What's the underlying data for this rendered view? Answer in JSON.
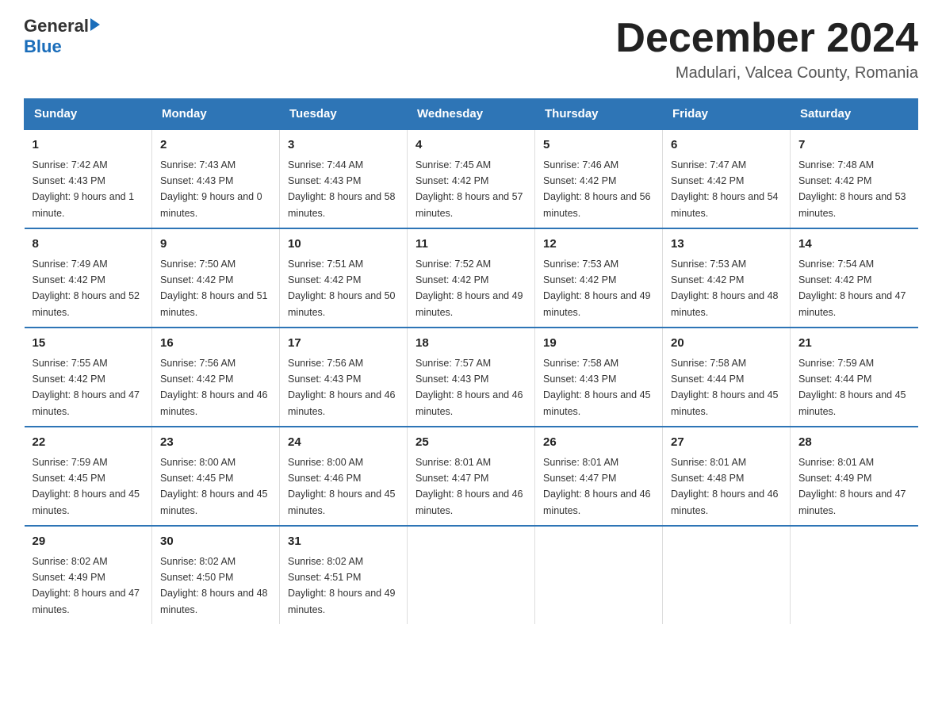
{
  "header": {
    "logo_general": "General",
    "logo_blue": "Blue",
    "month_title": "December 2024",
    "location": "Madulari, Valcea County, Romania"
  },
  "days_of_week": [
    "Sunday",
    "Monday",
    "Tuesday",
    "Wednesday",
    "Thursday",
    "Friday",
    "Saturday"
  ],
  "weeks": [
    [
      {
        "day": "1",
        "sunrise": "7:42 AM",
        "sunset": "4:43 PM",
        "daylight": "9 hours and 1 minute."
      },
      {
        "day": "2",
        "sunrise": "7:43 AM",
        "sunset": "4:43 PM",
        "daylight": "9 hours and 0 minutes."
      },
      {
        "day": "3",
        "sunrise": "7:44 AM",
        "sunset": "4:43 PM",
        "daylight": "8 hours and 58 minutes."
      },
      {
        "day": "4",
        "sunrise": "7:45 AM",
        "sunset": "4:42 PM",
        "daylight": "8 hours and 57 minutes."
      },
      {
        "day": "5",
        "sunrise": "7:46 AM",
        "sunset": "4:42 PM",
        "daylight": "8 hours and 56 minutes."
      },
      {
        "day": "6",
        "sunrise": "7:47 AM",
        "sunset": "4:42 PM",
        "daylight": "8 hours and 54 minutes."
      },
      {
        "day": "7",
        "sunrise": "7:48 AM",
        "sunset": "4:42 PM",
        "daylight": "8 hours and 53 minutes."
      }
    ],
    [
      {
        "day": "8",
        "sunrise": "7:49 AM",
        "sunset": "4:42 PM",
        "daylight": "8 hours and 52 minutes."
      },
      {
        "day": "9",
        "sunrise": "7:50 AM",
        "sunset": "4:42 PM",
        "daylight": "8 hours and 51 minutes."
      },
      {
        "day": "10",
        "sunrise": "7:51 AM",
        "sunset": "4:42 PM",
        "daylight": "8 hours and 50 minutes."
      },
      {
        "day": "11",
        "sunrise": "7:52 AM",
        "sunset": "4:42 PM",
        "daylight": "8 hours and 49 minutes."
      },
      {
        "day": "12",
        "sunrise": "7:53 AM",
        "sunset": "4:42 PM",
        "daylight": "8 hours and 49 minutes."
      },
      {
        "day": "13",
        "sunrise": "7:53 AM",
        "sunset": "4:42 PM",
        "daylight": "8 hours and 48 minutes."
      },
      {
        "day": "14",
        "sunrise": "7:54 AM",
        "sunset": "4:42 PM",
        "daylight": "8 hours and 47 minutes."
      }
    ],
    [
      {
        "day": "15",
        "sunrise": "7:55 AM",
        "sunset": "4:42 PM",
        "daylight": "8 hours and 47 minutes."
      },
      {
        "day": "16",
        "sunrise": "7:56 AM",
        "sunset": "4:42 PM",
        "daylight": "8 hours and 46 minutes."
      },
      {
        "day": "17",
        "sunrise": "7:56 AM",
        "sunset": "4:43 PM",
        "daylight": "8 hours and 46 minutes."
      },
      {
        "day": "18",
        "sunrise": "7:57 AM",
        "sunset": "4:43 PM",
        "daylight": "8 hours and 46 minutes."
      },
      {
        "day": "19",
        "sunrise": "7:58 AM",
        "sunset": "4:43 PM",
        "daylight": "8 hours and 45 minutes."
      },
      {
        "day": "20",
        "sunrise": "7:58 AM",
        "sunset": "4:44 PM",
        "daylight": "8 hours and 45 minutes."
      },
      {
        "day": "21",
        "sunrise": "7:59 AM",
        "sunset": "4:44 PM",
        "daylight": "8 hours and 45 minutes."
      }
    ],
    [
      {
        "day": "22",
        "sunrise": "7:59 AM",
        "sunset": "4:45 PM",
        "daylight": "8 hours and 45 minutes."
      },
      {
        "day": "23",
        "sunrise": "8:00 AM",
        "sunset": "4:45 PM",
        "daylight": "8 hours and 45 minutes."
      },
      {
        "day": "24",
        "sunrise": "8:00 AM",
        "sunset": "4:46 PM",
        "daylight": "8 hours and 45 minutes."
      },
      {
        "day": "25",
        "sunrise": "8:01 AM",
        "sunset": "4:47 PM",
        "daylight": "8 hours and 46 minutes."
      },
      {
        "day": "26",
        "sunrise": "8:01 AM",
        "sunset": "4:47 PM",
        "daylight": "8 hours and 46 minutes."
      },
      {
        "day": "27",
        "sunrise": "8:01 AM",
        "sunset": "4:48 PM",
        "daylight": "8 hours and 46 minutes."
      },
      {
        "day": "28",
        "sunrise": "8:01 AM",
        "sunset": "4:49 PM",
        "daylight": "8 hours and 47 minutes."
      }
    ],
    [
      {
        "day": "29",
        "sunrise": "8:02 AM",
        "sunset": "4:49 PM",
        "daylight": "8 hours and 47 minutes."
      },
      {
        "day": "30",
        "sunrise": "8:02 AM",
        "sunset": "4:50 PM",
        "daylight": "8 hours and 48 minutes."
      },
      {
        "day": "31",
        "sunrise": "8:02 AM",
        "sunset": "4:51 PM",
        "daylight": "8 hours and 49 minutes."
      },
      null,
      null,
      null,
      null
    ]
  ],
  "labels": {
    "sunrise": "Sunrise:",
    "sunset": "Sunset:",
    "daylight": "Daylight:"
  }
}
